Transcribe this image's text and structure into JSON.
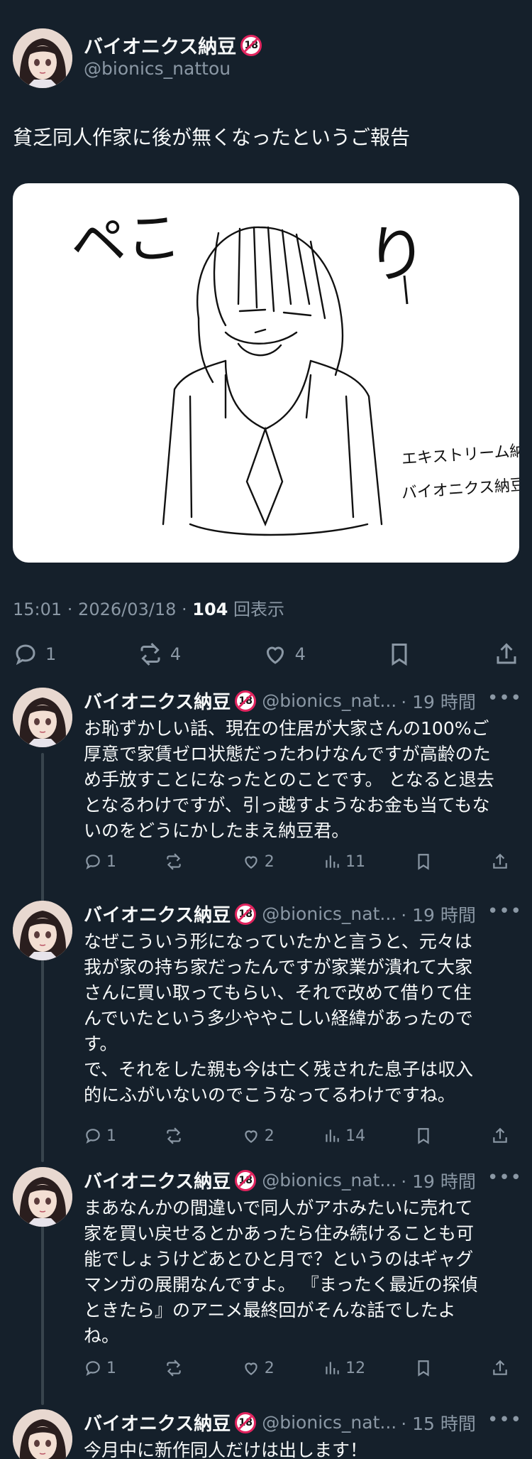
{
  "tweet": {
    "author_name": "バイオニクス納豆",
    "author_handle": "@bionics_nattou",
    "text": "貧乏同人作家に後が無くなったというご報告",
    "time": "15:01 · 2026/03/18 · ",
    "views_count": "104",
    "views_label": " 回表示",
    "replies": "1",
    "retweets": "4",
    "likes": "4",
    "image_text": {
      "peko": "ペこ",
      "ri": "り",
      "credit_line1": "エキストリーム納豆",
      "credit_line2": "バイオニクス納豆"
    }
  },
  "badge": "18",
  "more": "•••",
  "replies": [
    {
      "name": "バイオニクス納豆",
      "handle": "@bionics_nat...",
      "time": "· 19 時間",
      "text": "お恥ずかしい話、現在の住居が大家さんの100%ご\n厚意で家賃ゼロ状態だったわけなんですが高齢のた\nめ手放すことになったとのことです。 となると退去\nとなるわけですが、引っ越すようなお金も当てもな\nいのをどうにかしたまえ納豆君。",
      "replies": "1",
      "likes": "2",
      "views": "11"
    },
    {
      "name": "バイオニクス納豆",
      "handle": "@bionics_nat...",
      "time": "· 19 時間",
      "text": "なぜこういう形になっていたかと言うと、元々は\n我が家の持ち家だったんですが家業が潰れて大家\nさんに買い取ってもらい、それで改めて借りて住\nんでいたという多少ややこしい経緯があったので\nす。\nで、それをした親も今は亡く残された息子は収入\n的にふがいないのでこうなってるわけですね。",
      "replies": "1",
      "likes": "2",
      "views": "14"
    },
    {
      "name": "バイオニクス納豆",
      "handle": "@bionics_nat...",
      "time": "· 19 時間",
      "text": "まあなんかの間違いで同人がアホみたいに売れて\n家を買い戻せるとかあったら住み続けることも可\n能でしょうけどあとひと月で？というのはギャグ\nマンガの展開なんですよ。 『まったく最近の探偵\nときたら』のアニメ最終回がそんな話でしたよ\nね。",
      "replies": "1",
      "likes": "2",
      "views": "12"
    },
    {
      "name": "バイオニクス納豆",
      "handle": "@bionics_nat...",
      "time": "· 15 時間",
      "text": "今月中に新作同人だけは出します！"
    }
  ]
}
